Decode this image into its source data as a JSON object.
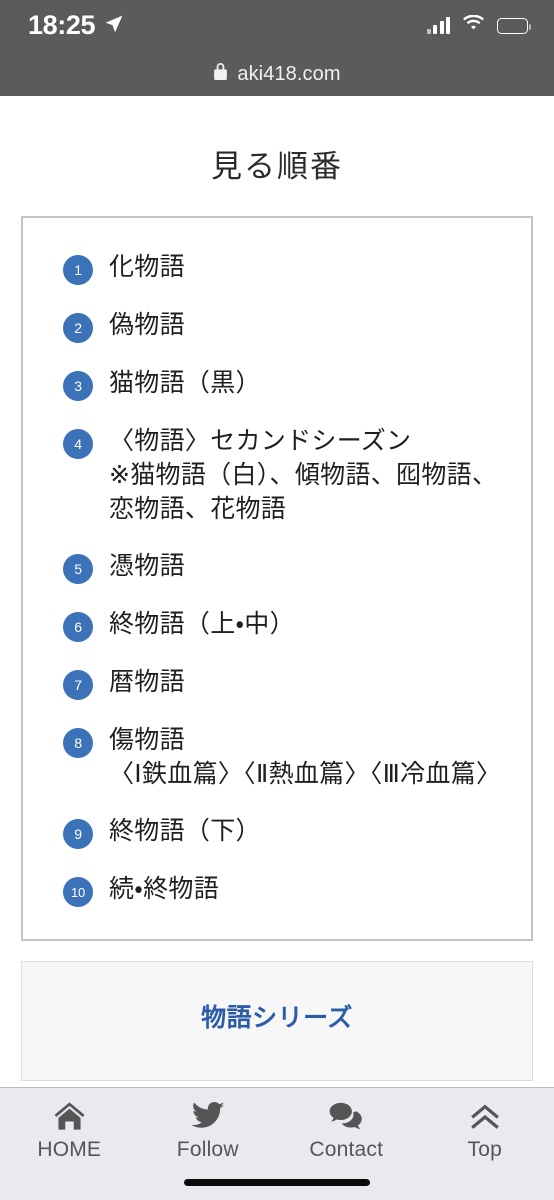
{
  "status_bar": {
    "time": "18:25",
    "location_icon": "location-arrow-icon",
    "signal_icon": "cellular-signal-icon",
    "wifi_icon": "wifi-icon",
    "battery_icon": "battery-icon"
  },
  "browser": {
    "lock_icon": "lock-icon",
    "url": "aki418.com"
  },
  "page": {
    "title": "見る順番"
  },
  "order_list": [
    {
      "number": "1",
      "title": "化物語",
      "sub": ""
    },
    {
      "number": "2",
      "title": "偽物語",
      "sub": ""
    },
    {
      "number": "3",
      "title": "猫物語（黒）",
      "sub": ""
    },
    {
      "number": "4",
      "title": "〈物語〉セカンドシーズン",
      "sub": "※猫物語（白）、傾物語、囮物語、恋物語、花物語"
    },
    {
      "number": "5",
      "title": "憑物語",
      "sub": ""
    },
    {
      "number": "6",
      "title": "終物語（上・中）",
      "sub": ""
    },
    {
      "number": "7",
      "title": "暦物語",
      "sub": ""
    },
    {
      "number": "8",
      "title": "傷物語",
      "sub": "〈Ⅰ鉄血篇〉〈Ⅱ熱血篇〉〈Ⅲ冷血篇〉"
    },
    {
      "number": "9",
      "title": "終物語（下）",
      "sub": ""
    },
    {
      "number": "10",
      "title": "続・終物語",
      "sub": ""
    }
  ],
  "next_section": {
    "partial_text": "物語シリーズ"
  },
  "bottom_nav": [
    {
      "label": "HOME",
      "icon": "home-icon"
    },
    {
      "label": "Follow",
      "icon": "twitter-bird-icon"
    },
    {
      "label": "Contact",
      "icon": "speech-bubbles-icon"
    },
    {
      "label": "Top",
      "icon": "chevron-double-up-icon"
    }
  ],
  "colors": {
    "badge_blue": "#3c72b8",
    "status_bar_gray": "#5b5b5b",
    "nav_bar_gray": "#e8eaee",
    "box_border": "#c3c4c8"
  }
}
